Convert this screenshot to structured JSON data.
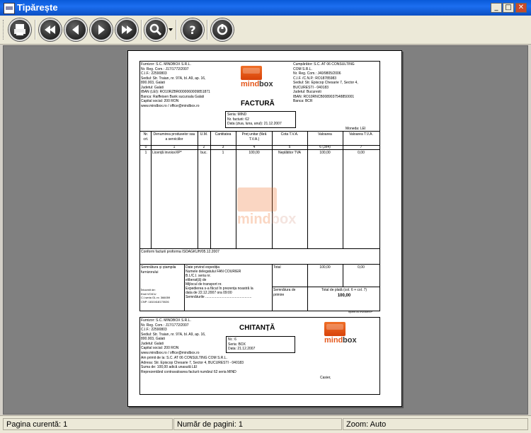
{
  "window": {
    "title": "Tipărește",
    "minimize": "_",
    "maximize": "□",
    "close": "✕"
  },
  "toolbar": {
    "buttons": [
      {
        "name": "print-icon"
      },
      {
        "name": "first-page-icon"
      },
      {
        "name": "previous-page-icon"
      },
      {
        "name": "next-page-icon"
      },
      {
        "name": "last-page-icon"
      },
      {
        "name": "zoom-icon"
      },
      {
        "name": "help-icon"
      },
      {
        "name": "close-power-icon"
      }
    ]
  },
  "colors": {
    "logo_orange": "#e4571b",
    "titlebar": "#1c6ef0"
  },
  "invoice": {
    "supplier": [
      "Furnizor: S.C. MINDBOX S.R.L.",
      "Nr. Reg. Com.: J17/1772/2007",
      "C.I.F.: 22590803",
      "Sediul: Str. Traian, nr. 97A, bl. A9, ap. 16,",
      "800.003, Galati",
      "Judetul: Galati",
      "IBAN (LEI): RO10RZBR0000060009851871",
      "Banca: Raiffeisen Bank sucursala Galati",
      "Capital social: 200 RON",
      "www.mindbox.ro / office@mindbox.ro"
    ],
    "buyer": [
      "Cumpărător: S.C. AT 06 CONSULTING",
      "COM S.R.L.",
      "Nr. Reg. Com.: J40/9805/2006",
      "C.I.F. /C.N.P.: RO18785983",
      "Sediul: Str. Episcop Chesarie 7, Sector 4,",
      "BUCURESTI - 040183",
      "Judetul: Bucuresti",
      "IBAN: RO10RNCB0089037548850001",
      "Banca: BCR"
    ],
    "logo_word1": "mind",
    "logo_word2": "box",
    "title": "FACTURĂ",
    "series_box": [
      "Seria: MIND",
      "Nr. facturii: 62",
      "Data (ziua, luna, anul): 21.12.2007"
    ],
    "currency": "Moneda: LEI",
    "columns": [
      "Nr. crt.",
      "Denumirea produselor sau a serviciilor",
      "U.M.",
      "Cantitatea",
      "Preț unitar (fără T.V.A.)",
      "Cota T.V.A.",
      "Valoarea",
      "Valoarea T.V.A."
    ],
    "col_numbers": [
      "0",
      "1",
      "2",
      "3",
      "4",
      "5",
      "6 (3x4)",
      "7"
    ],
    "row": [
      "1",
      "Licență invoiceXP*",
      "buc.",
      "1",
      "100,00",
      "Neplătitor TVA",
      "100,00",
      "0,00"
    ],
    "watermark1": "mind",
    "watermark2": "box",
    "note": "Conform facturii proforma ISOAGKUH/05.12.2007",
    "sig_label": "Semnătura și ștampila furnizorului",
    "issuer": [
      "Întocmit de:",
      "Emil VOICU",
      "C.I.seria GL nr. 366059",
      "CNP: 1810418170026"
    ],
    "shipping": [
      "Date privind expediția",
      "Numele delegatului FAN COURIER",
      "B.I./C.I. seria nr.",
      "eliberat(ă) de",
      "Mijlocul de transport  nr.",
      "Expedierea s-a făcut în prezența noastră la",
      "data de 22.12.2007 ora 09:00",
      "Semnăturile ..............................................."
    ],
    "total_label": "Total",
    "total_value": "100,00",
    "total_vat": "0,00",
    "receipt_sig": "Semnătura de primire",
    "grand_label": "Total de plată (col. 6 + col. 7)",
    "grand_value": "100,00",
    "footer": "Tipărit cu invoiceXP"
  },
  "receipt": {
    "supplier": [
      "Furnizor: S.C. MINDBOX S.R.L.",
      "Nr. Reg. Com.: J17/1772/2007",
      "C.I.F.: 22590803",
      "Sediul: Str. Traian, nr. 97A, bl. A9, ap. 16,",
      "800.003, Galati",
      "Judetul: Galati",
      "Capital social: 200 RON",
      "www.mindbox.ro / office@mindbox.ro"
    ],
    "title": "CHITANȚĂ",
    "box": [
      "Nr.: 6",
      "Seria: BOX",
      "Data: 21.12.2007"
    ],
    "body": [
      "Am primit de la: S.C. AT 06 CONSULTING COM S.R.L.",
      "Adresa: Str. Episcop Chesarie 7, Sector 4, BUCURESTI - 040183",
      "Suma de: 100,00 adică unasută LEI",
      "Reprezentând contravaloarea facturii numărul 62 seria MIND"
    ],
    "cashier": "Casier,"
  },
  "status": {
    "page": "Pagina curentă: 1",
    "pages": "Număr de pagini: 1",
    "zoom": "Zoom: Auto"
  }
}
